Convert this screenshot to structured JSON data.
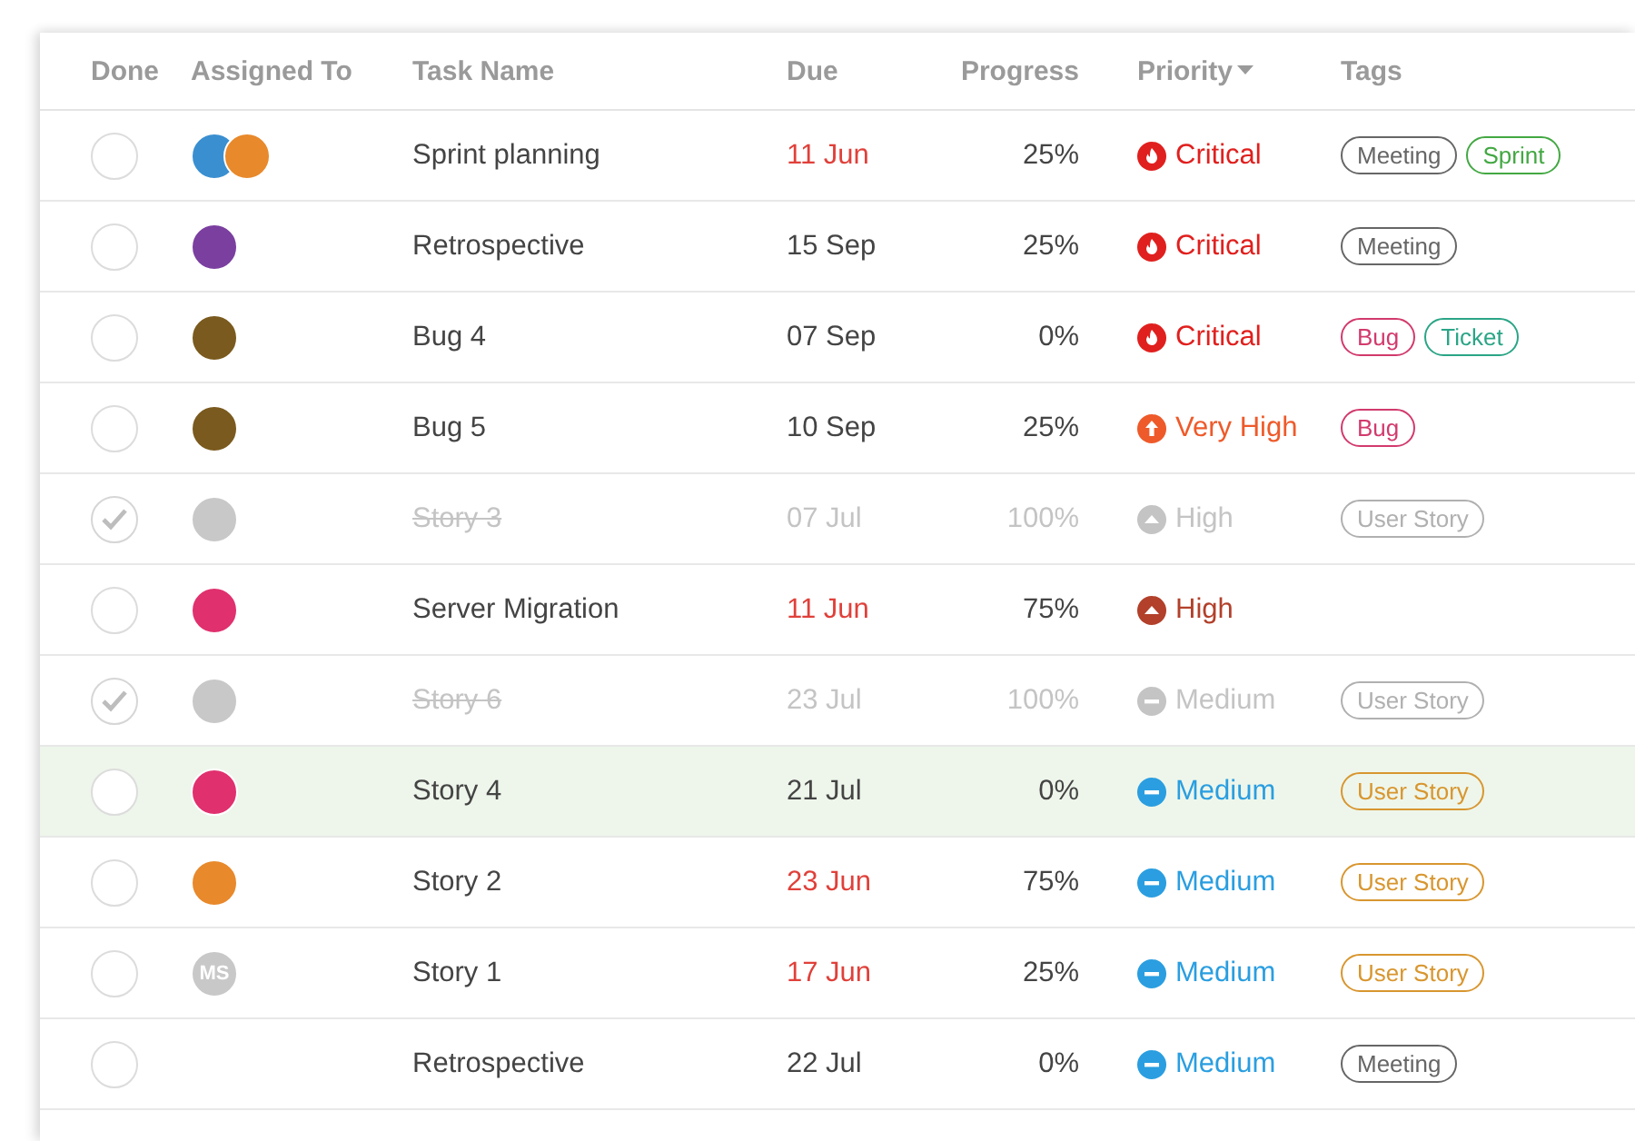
{
  "columns": [
    {
      "label": "Done"
    },
    {
      "label": "Assigned To"
    },
    {
      "label": "Task Name"
    },
    {
      "label": "Due"
    },
    {
      "label": "Progress"
    },
    {
      "label": "Priority",
      "sorted": true
    },
    {
      "label": "Tags"
    }
  ],
  "rows": [
    {
      "done": false,
      "selected": false,
      "avatars": [
        {
          "kind": "photo",
          "color": "#3a8fd0"
        },
        {
          "kind": "photo",
          "color": "#e8892b"
        }
      ],
      "task": "Sprint planning",
      "due": "11 Jun",
      "overdue": true,
      "progress": "25%",
      "priority": {
        "kind": "critical",
        "label": "Critical"
      },
      "tags": [
        {
          "label": "Meeting",
          "color": "#666666"
        },
        {
          "label": "Sprint",
          "color": "#43a843"
        }
      ]
    },
    {
      "done": false,
      "selected": false,
      "avatars": [
        {
          "kind": "photo",
          "color": "#7b3fa0"
        }
      ],
      "task": "Retrospective",
      "due": "15 Sep",
      "overdue": false,
      "progress": "25%",
      "priority": {
        "kind": "critical",
        "label": "Critical"
      },
      "tags": [
        {
          "label": "Meeting",
          "color": "#666666"
        }
      ]
    },
    {
      "done": false,
      "selected": false,
      "avatars": [
        {
          "kind": "photo",
          "color": "#7a5a1e"
        }
      ],
      "task": "Bug 4",
      "due": "07 Sep",
      "overdue": false,
      "progress": "0%",
      "priority": {
        "kind": "critical",
        "label": "Critical"
      },
      "tags": [
        {
          "label": "Bug",
          "color": "#d23a6c"
        },
        {
          "label": "Ticket",
          "color": "#2aa586"
        }
      ]
    },
    {
      "done": false,
      "selected": false,
      "avatars": [
        {
          "kind": "photo",
          "color": "#7a5a1e"
        }
      ],
      "task": "Bug 5",
      "due": "10 Sep",
      "overdue": false,
      "progress": "25%",
      "priority": {
        "kind": "very_high",
        "label": "Very High"
      },
      "tags": [
        {
          "label": "Bug",
          "color": "#d23a6c"
        }
      ]
    },
    {
      "done": true,
      "selected": false,
      "avatars": [
        {
          "kind": "photo",
          "color": "#c8c8c8"
        }
      ],
      "task": "Story 3",
      "due": "07 Jul",
      "progress": "100%",
      "priority": {
        "kind": "high",
        "label": "High"
      },
      "tags": [
        {
          "label": "User Story",
          "color": "#b0b0b0"
        }
      ]
    },
    {
      "done": false,
      "selected": false,
      "avatars": [
        {
          "kind": "photo",
          "color": "#e0306e"
        }
      ],
      "task": "Server Migration",
      "due": "11 Jun",
      "overdue": true,
      "progress": "75%",
      "priority": {
        "kind": "high",
        "label": "High"
      },
      "tags": []
    },
    {
      "done": true,
      "selected": false,
      "avatars": [
        {
          "kind": "photo",
          "color": "#c8c8c8"
        }
      ],
      "task": "Story 6",
      "due": "23 Jul",
      "progress": "100%",
      "priority": {
        "kind": "medium",
        "label": "Medium"
      },
      "tags": [
        {
          "label": "User Story",
          "color": "#b0b0b0"
        }
      ]
    },
    {
      "done": false,
      "selected": true,
      "avatars": [
        {
          "kind": "photo",
          "color": "#e0306e"
        }
      ],
      "task": "Story 4",
      "due": "21 Jul",
      "overdue": false,
      "progress": "0%",
      "priority": {
        "kind": "medium",
        "label": "Medium"
      },
      "tags": [
        {
          "label": "User Story",
          "color": "#d8962f"
        }
      ]
    },
    {
      "done": false,
      "selected": false,
      "avatars": [
        {
          "kind": "photo",
          "color": "#e8892b"
        }
      ],
      "task": "Story 2",
      "due": "23 Jun",
      "overdue": true,
      "progress": "75%",
      "priority": {
        "kind": "medium",
        "label": "Medium"
      },
      "tags": [
        {
          "label": "User Story",
          "color": "#d8962f"
        }
      ]
    },
    {
      "done": false,
      "selected": false,
      "avatars": [
        {
          "kind": "initials",
          "initials": "MS",
          "color": "#c8c8c8"
        }
      ],
      "task": "Story 1",
      "due": "17 Jun",
      "overdue": true,
      "progress": "25%",
      "priority": {
        "kind": "medium",
        "label": "Medium"
      },
      "tags": [
        {
          "label": "User Story",
          "color": "#d8962f"
        }
      ]
    },
    {
      "done": false,
      "selected": false,
      "avatars": [],
      "task": "Retrospective",
      "due": "22 Jul",
      "overdue": false,
      "progress": "0%",
      "priority": {
        "kind": "medium",
        "label": "Medium"
      },
      "tags": [
        {
          "label": "Meeting",
          "color": "#666666"
        }
      ]
    }
  ]
}
